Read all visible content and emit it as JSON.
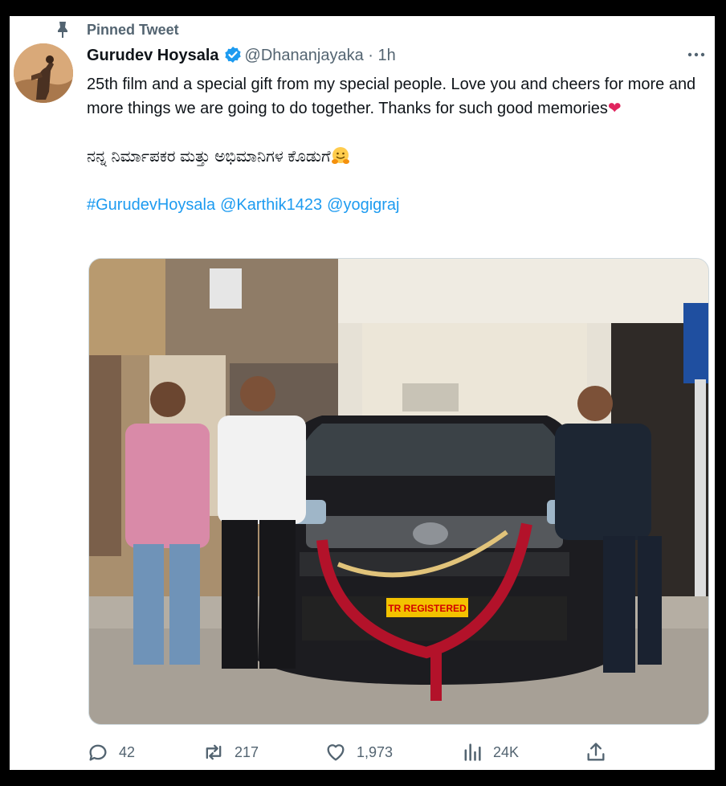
{
  "pinned": {
    "label": "Pinned Tweet"
  },
  "author": {
    "name": "Gurudev Hoysala",
    "handle": "@Dhananjayaka",
    "time": "1h",
    "separator": "·"
  },
  "tweet": {
    "line1": "25th film and a special gift from my special people. Love you and cheers for more and more things we are going to do together. Thanks for such good memories",
    "heart": "❤",
    "kannada": "ನನ್ನ ನಿರ್ಮಾಪಕರ ಮತ್ತು ಅಭಿಮಾನಿಗಳ ಕೊಡುಗೆ",
    "tags": [
      "#GurudevHoysala",
      "@Karthik1423",
      "@yogigraj"
    ]
  },
  "photo": {
    "plate_text": "TR REGISTERED"
  },
  "metrics": {
    "replies": "42",
    "retweets": "217",
    "likes": "1,973",
    "views": "24K"
  },
  "colors": {
    "accent": "#1d9bf0",
    "secondary_text": "#536471",
    "heart": "#e0245e"
  }
}
